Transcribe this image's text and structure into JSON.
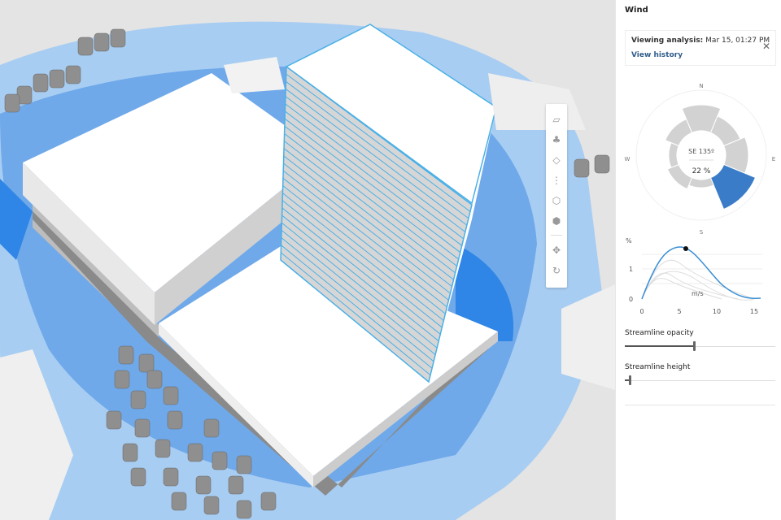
{
  "panel": {
    "title": "Wind",
    "analysis": {
      "label": "Viewing analysis:",
      "value": "Mar 15, 01:27 PM",
      "history_link": "View history"
    },
    "wind_rose": {
      "directions": [
        "N",
        "E",
        "S",
        "W"
      ],
      "selected_direction": "SE 135º",
      "selected_percent": "22 %",
      "highlight_color": "#3a7cc8"
    },
    "chart": {
      "y_unit": "%",
      "x_unit": "m/s",
      "y_ticks": [
        "0",
        "1"
      ],
      "x_ticks": [
        "0",
        "5",
        "10",
        "15"
      ]
    },
    "sliders": [
      {
        "label": "Streamline opacity",
        "value_percent": 46
      },
      {
        "label": "Streamline height",
        "value_percent": 3
      }
    ]
  },
  "toolbar": {
    "tools": [
      "building-tool",
      "tree-tool",
      "surface-tool",
      "line-tool",
      "box-tool",
      "model-tool",
      "move-tool",
      "rotate-tool"
    ]
  }
}
